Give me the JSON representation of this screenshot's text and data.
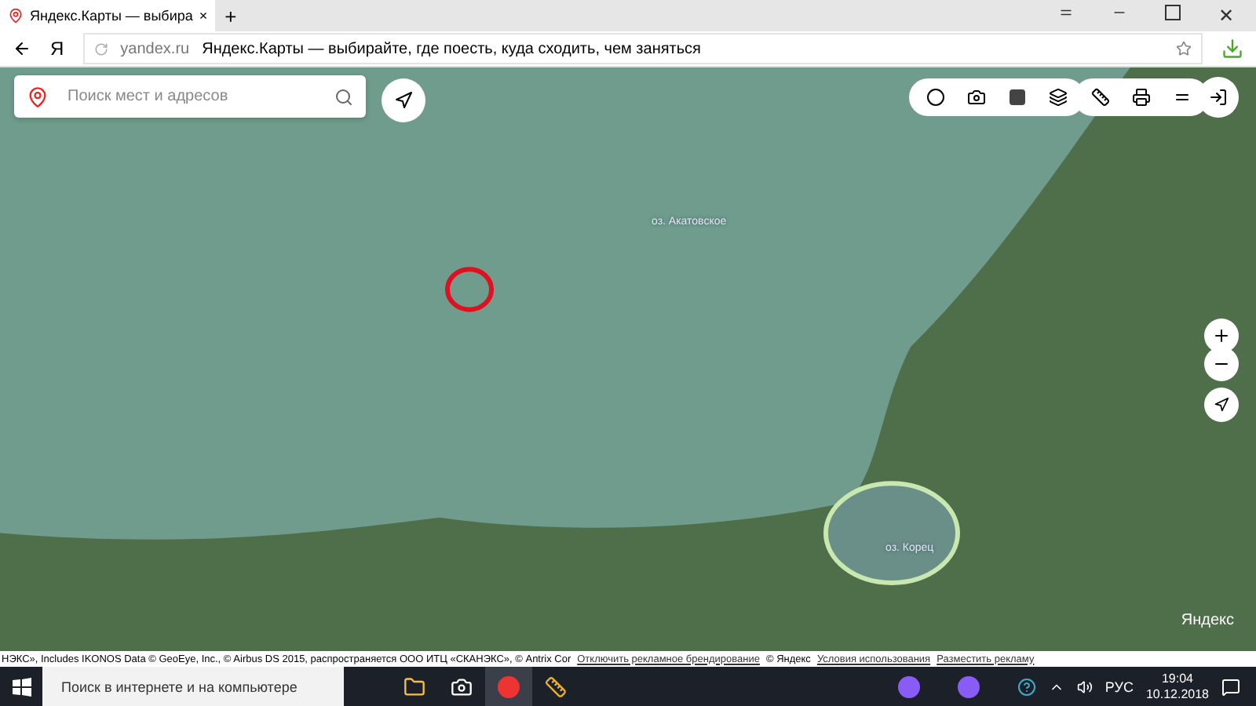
{
  "browser": {
    "tab": {
      "title": "Яндекс.Карты — выбира",
      "close": "×"
    },
    "new_tab": "+",
    "address": {
      "host": "yandex.ru",
      "page_title": "Яндекс.Карты — выбирайте, где поесть, куда сходить, чем заняться"
    },
    "logo_letter": "Я",
    "close_window": "✕"
  },
  "map": {
    "search": {
      "placeholder": "Поиск мест и адресов"
    },
    "labels": [
      {
        "text": "оз. Акатовское"
      },
      {
        "text": "оз. Корец"
      }
    ],
    "logo": "Яндекс",
    "attribution": [
      {
        "kind": "text",
        "text": "НЭКС», Includes IKONOS Data © GeoEye, Inc., © Airbus DS 2015, распространяется ООО ИТЦ «СКАНЭКС», © Antrix Cor"
      },
      {
        "kind": "link",
        "text": "Отключить рекламное брендирование"
      },
      {
        "kind": "text",
        "text": "© Яндекс"
      },
      {
        "kind": "link",
        "text": "Условия использования"
      },
      {
        "kind": "link",
        "text": "Разместить рекламу"
      }
    ]
  },
  "taskbar": {
    "search_placeholder": "Поиск в интернете и на компьютере",
    "language": "РУС",
    "time": "19:04",
    "date": "10.12.2018"
  }
}
